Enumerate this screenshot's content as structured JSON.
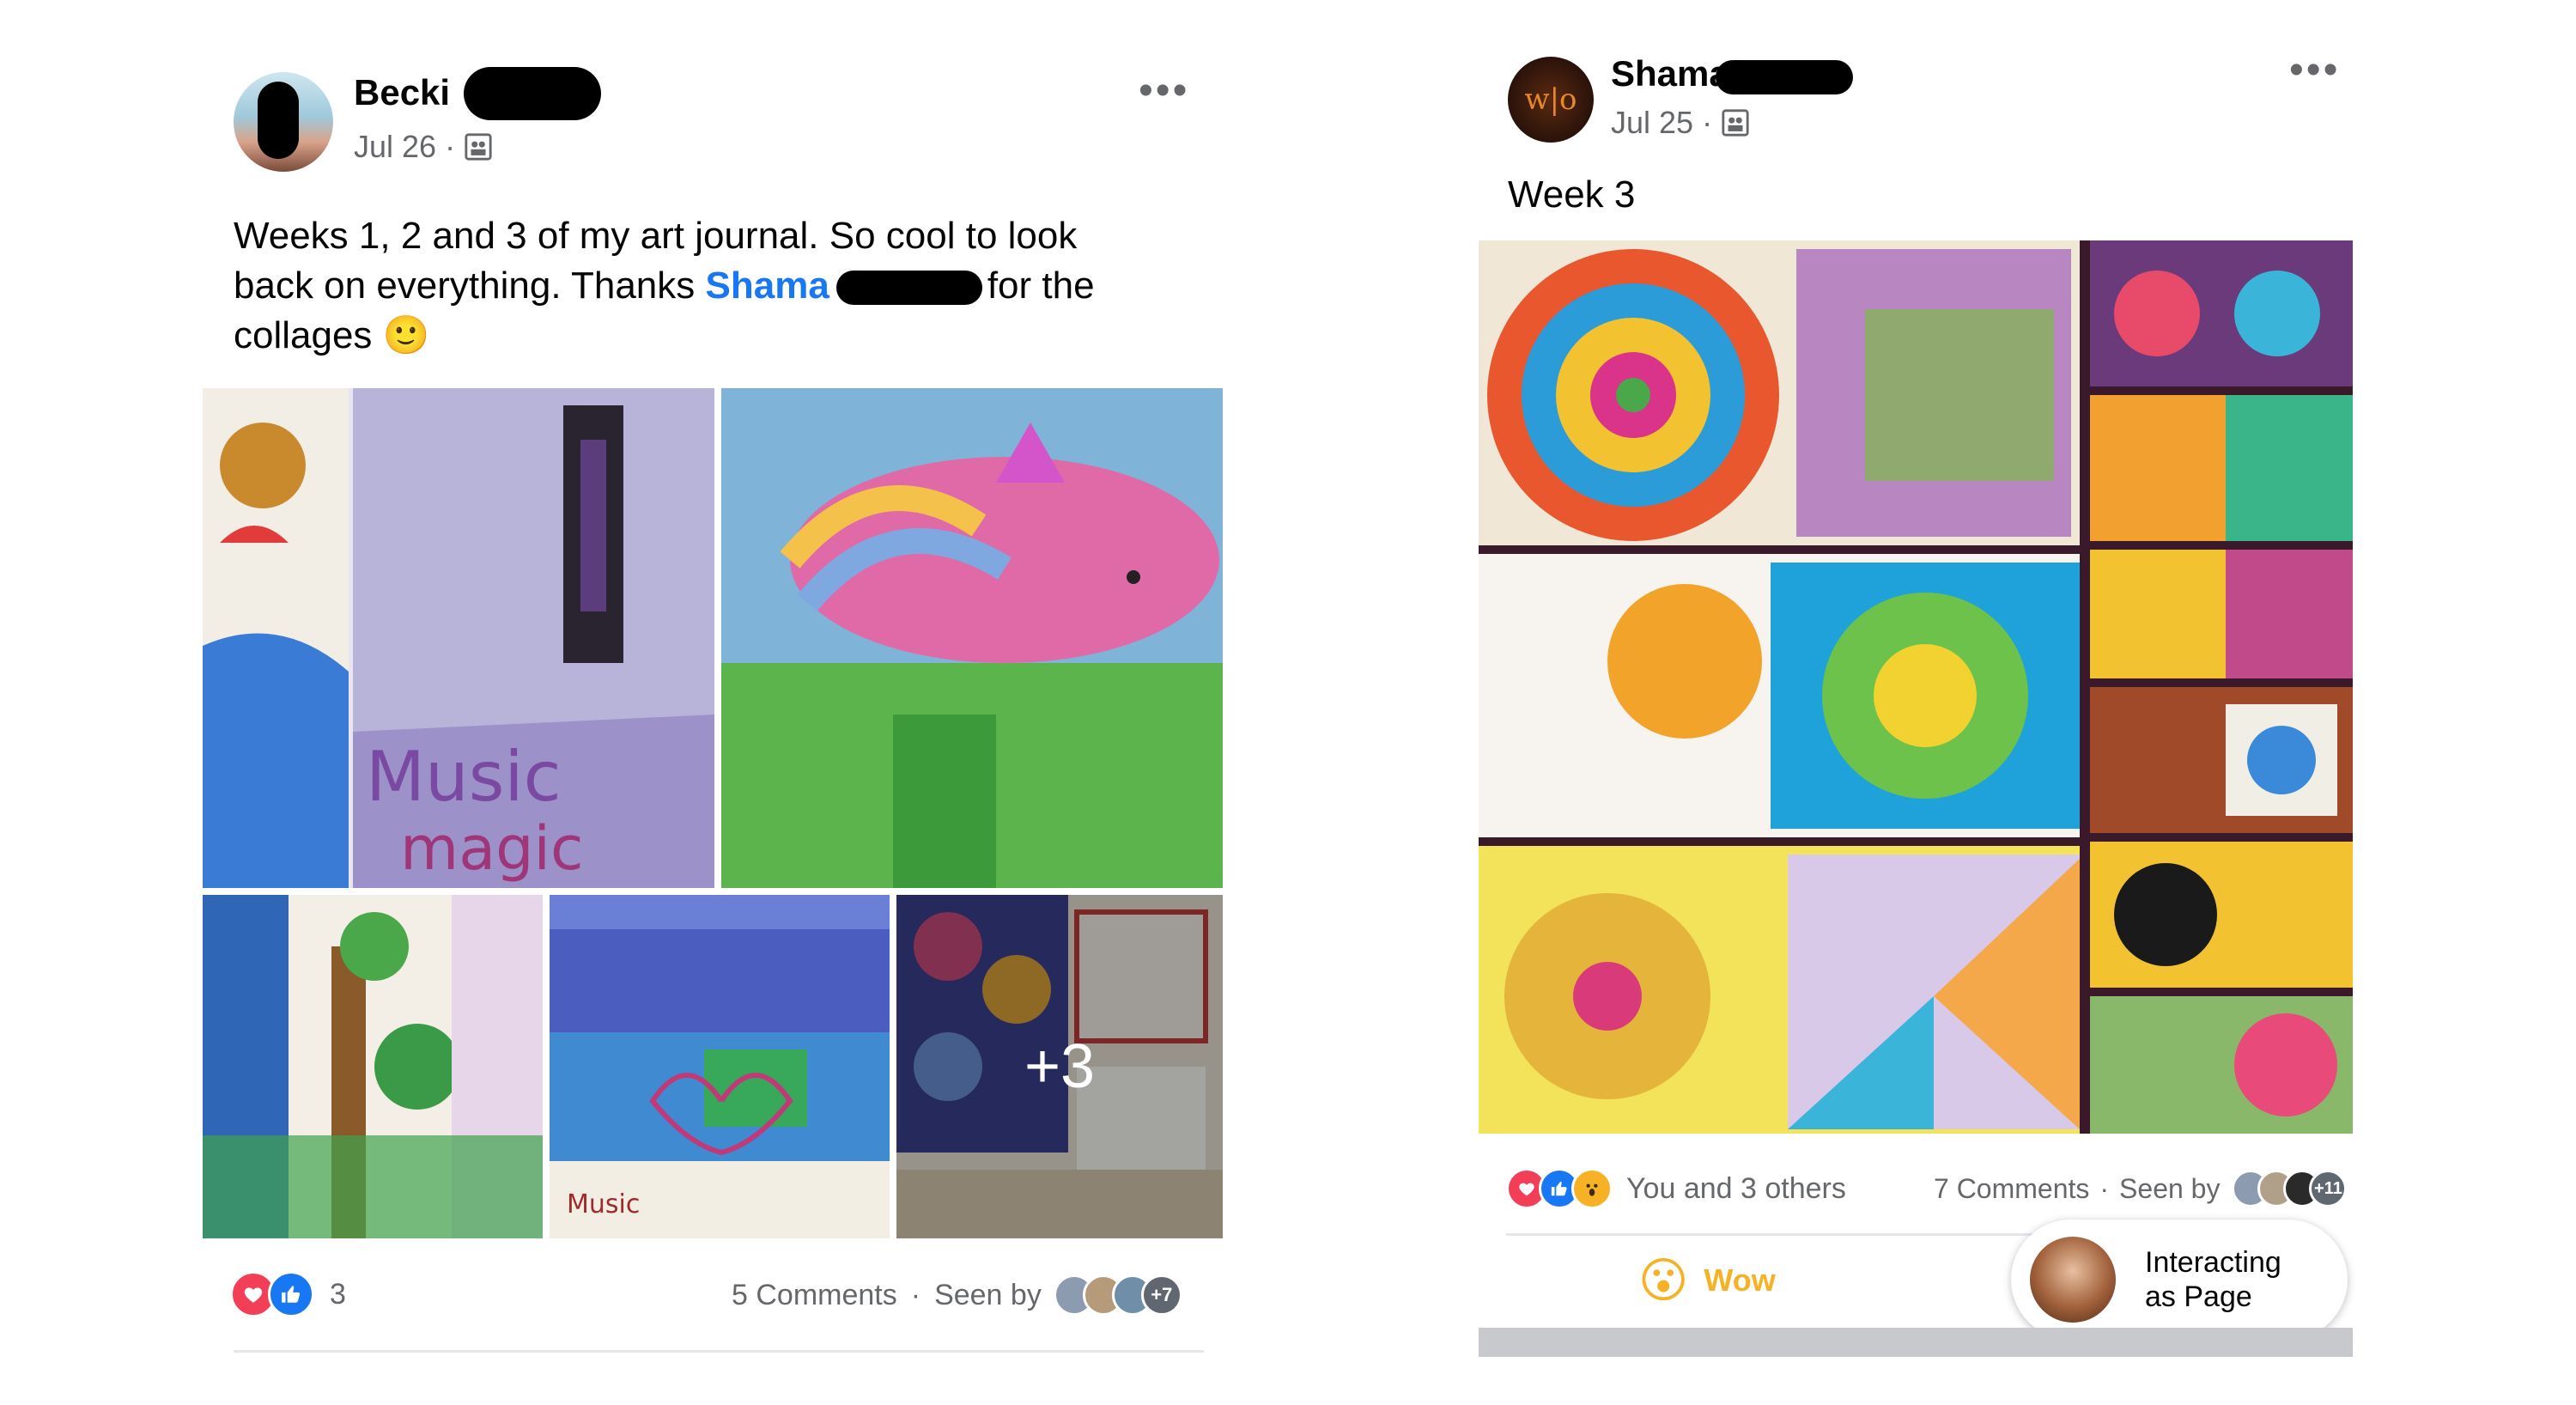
{
  "left_post": {
    "author": "Becki",
    "date": "Jul 26",
    "separator": "·",
    "audience_icon": "group-icon",
    "more_icon": "•••",
    "text_before": "Weeks 1, 2 and 3 of my art journal. So cool to look back on everything. Thanks ",
    "mention": "Shama",
    "text_after": "for the collages",
    "emoji": "🙂",
    "photos_extra": "+3",
    "reactions_count": "3",
    "comments": "5 Comments",
    "seen_by": "Seen by",
    "seen_extra": "+7"
  },
  "right_post": {
    "author": "Shama",
    "date": "Jul 25",
    "separator": "·",
    "audience_icon": "group-icon",
    "more_icon": "•••",
    "text": "Week 3",
    "reactions_label": "You and 3 others",
    "comments": "7 Comments",
    "seen_by": "Seen by",
    "seen_extra": "+11",
    "wow_label": "Wow",
    "wow_emoji": "😮",
    "interacting_as": "Interacting as Page"
  },
  "colors": {
    "mention": "#1877f2",
    "like_blue": "#1877f2",
    "love_red": "#f33e58",
    "wow_yellow": "#f7b125",
    "meta_grey": "#65676b"
  }
}
